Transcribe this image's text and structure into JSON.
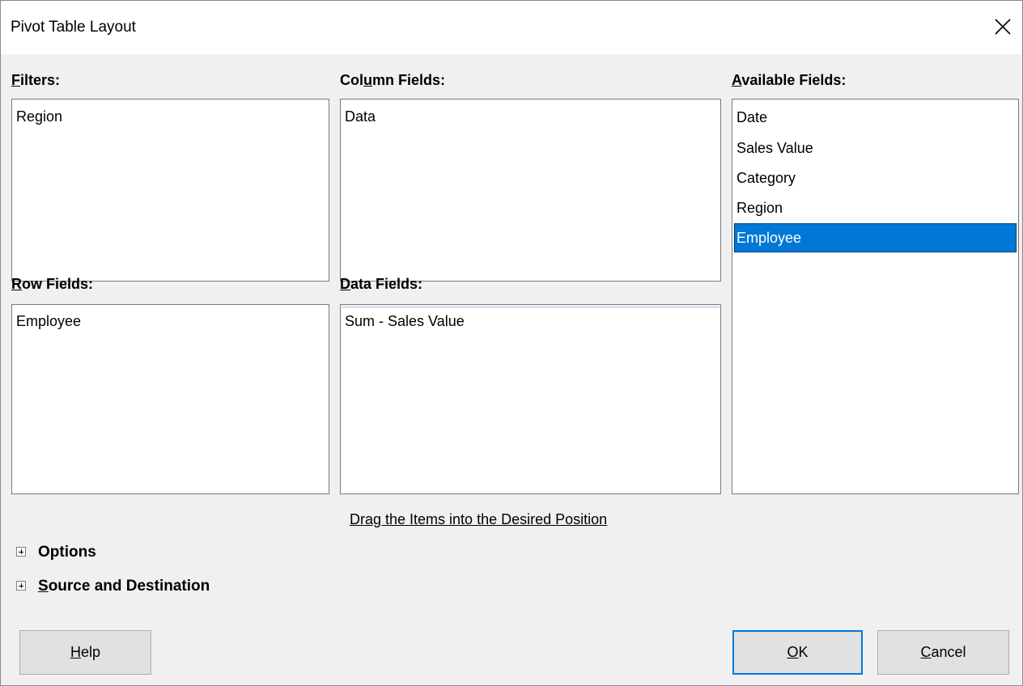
{
  "window": {
    "title": "Pivot Table Layout"
  },
  "filters": {
    "label_mnemonic": "F",
    "label_rest": "ilters:",
    "items": [
      "Region"
    ]
  },
  "column_fields": {
    "label_pre": "Col",
    "label_mnemonic": "u",
    "label_post": "mn Fields:",
    "items": [
      "Data"
    ]
  },
  "available_fields": {
    "label_mnemonic": "A",
    "label_rest": "vailable Fields:",
    "items": [
      "Date",
      "Sales Value",
      "Category",
      "Region",
      "Employee"
    ],
    "selected": "Employee"
  },
  "row_fields": {
    "label_mnemonic": "R",
    "label_rest": "ow Fields:",
    "items": [
      "Employee"
    ]
  },
  "data_fields": {
    "label_mnemonic": "D",
    "label_rest": "ata Fields:",
    "items": [
      "Sum - Sales Value"
    ]
  },
  "hint": "Drag the Items into the Desired Position",
  "expanders": {
    "options": {
      "label": "Options"
    },
    "source_destination": {
      "label_mnemonic": "S",
      "label_rest": "ource and Destination"
    }
  },
  "buttons": {
    "help": {
      "mnemonic": "H",
      "rest": "elp"
    },
    "ok": {
      "mnemonic": "O",
      "rest": "K"
    },
    "cancel": {
      "mnemonic": "C",
      "rest": "ancel"
    }
  },
  "icons": {
    "close": "close-icon",
    "expand": "plus-box-icon"
  },
  "colors": {
    "selection": "#0078d7",
    "default_button_border": "#0078d7"
  }
}
